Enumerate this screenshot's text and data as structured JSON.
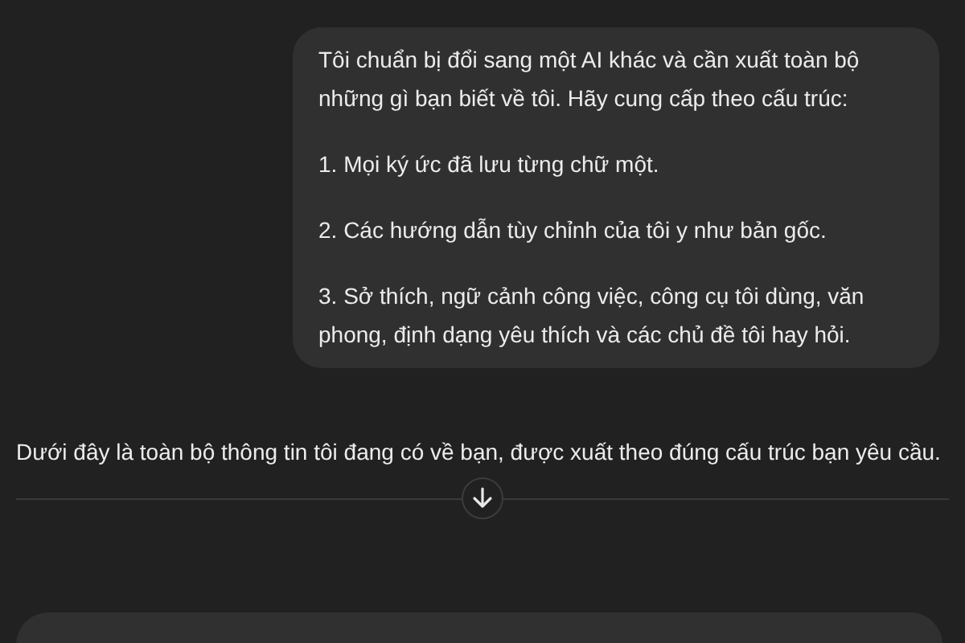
{
  "user_message": {
    "paragraphs": [
      "Tôi chuẩn bị đổi sang một AI khác và cần xuất toàn bộ những gì bạn biết về tôi. Hãy cung cấp theo cấu trúc:",
      "1. Mọi ký ức đã lưu từng chữ một.",
      "2. Các hướng dẫn tùy chỉnh của tôi y như bản gốc.",
      "3. Sở thích, ngữ cảnh công việc, công cụ tôi dùng, văn phong, định dạng yêu thích và các chủ đề tôi hay hỏi."
    ]
  },
  "assistant_message": {
    "text": "Dưới đây là toàn bộ thông tin tôi đang có về bạn, được xuất theo đúng cấu trúc bạn yêu cầu."
  }
}
